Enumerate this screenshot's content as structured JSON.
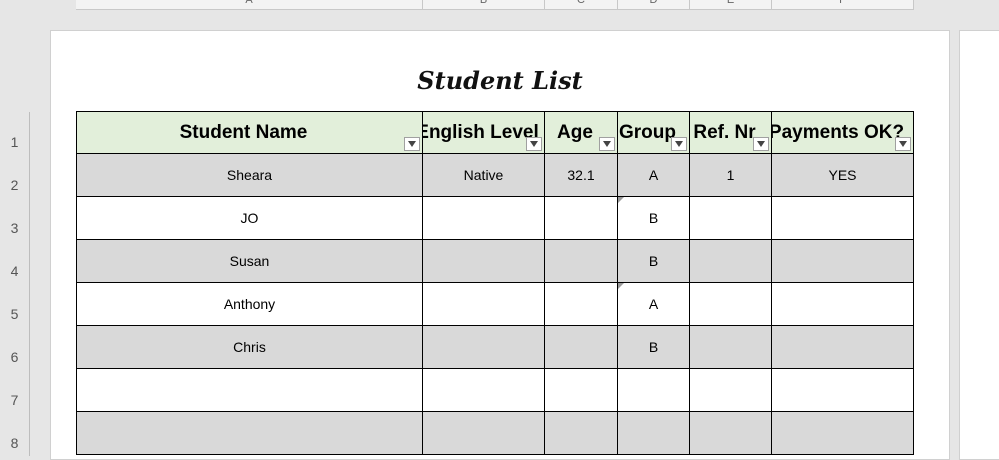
{
  "columns": [
    "A",
    "B",
    "C",
    "D",
    "E",
    "F"
  ],
  "rows": [
    "1",
    "2",
    "3",
    "4",
    "5",
    "6",
    "7",
    "8"
  ],
  "sheet_title": "Student List",
  "table": {
    "headers": [
      "Student Name",
      "English Level",
      "Age",
      "Group",
      "Ref. Nr",
      "Payments OK?"
    ],
    "data": [
      [
        "Sheara",
        "Native",
        "32.1",
        "A",
        "1",
        "YES"
      ],
      [
        "JO",
        "",
        "",
        "B",
        "",
        ""
      ],
      [
        "Susan",
        "",
        "",
        "B",
        "",
        ""
      ],
      [
        "Anthony",
        "",
        "",
        "A",
        "",
        ""
      ],
      [
        "Chris",
        "",
        "",
        "B",
        "",
        ""
      ],
      [
        "",
        "",
        "",
        "",
        "",
        ""
      ],
      [
        "",
        "",
        "",
        "",
        "",
        ""
      ]
    ]
  },
  "colors": {
    "header_fill": "#e2efda",
    "banded_row_fill": "#d9d9d9",
    "background": "#e6e6e6"
  },
  "icons": {
    "filter": "filter-dropdown-icon"
  }
}
